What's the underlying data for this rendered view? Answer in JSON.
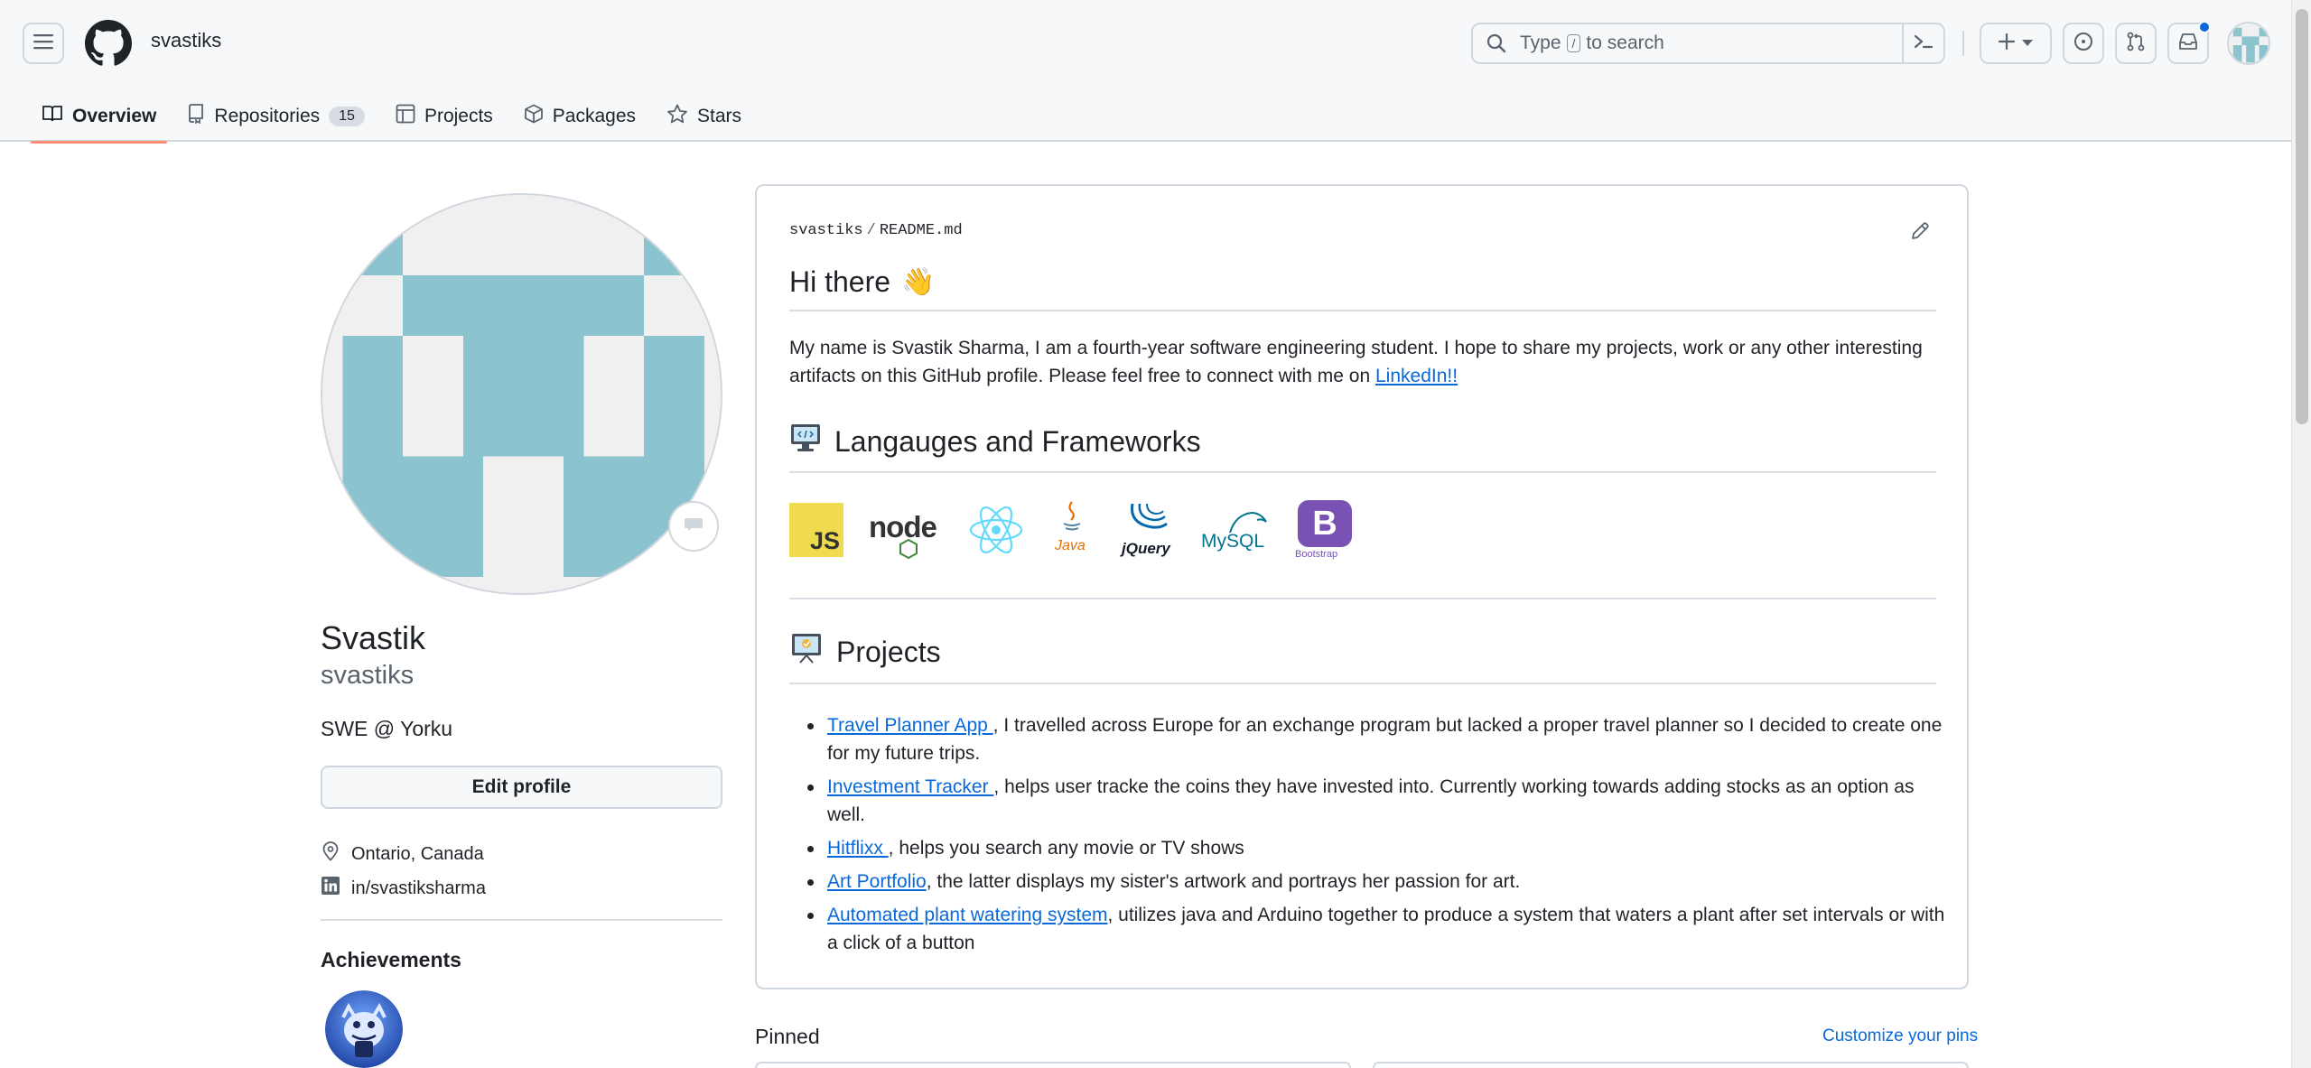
{
  "header": {
    "owner": "svastiks",
    "search": {
      "prefix": "Type",
      "key": "/",
      "suffix": "to search"
    },
    "create_label": "+"
  },
  "tabs": [
    {
      "label": "Overview",
      "icon": "book-icon",
      "active": true
    },
    {
      "label": "Repositories",
      "icon": "repo-icon",
      "count": "15"
    },
    {
      "label": "Projects",
      "icon": "table-icon"
    },
    {
      "label": "Packages",
      "icon": "package-icon"
    },
    {
      "label": "Stars",
      "icon": "star-icon"
    }
  ],
  "profile": {
    "display_name": "Svastik",
    "login": "svastiks",
    "bio": "SWE @ Yorku",
    "edit_label": "Edit profile",
    "location": "Ontario, Canada",
    "linkedin": "in/svastiksharma",
    "achievements_title": "Achievements"
  },
  "readme": {
    "path_owner": "svastiks",
    "path_sep": "/",
    "path_file": "README.md",
    "heading": "Hi there",
    "heading_emoji": "👋",
    "intro": "My name is Svastik Sharma, I am a fourth-year software engineering student. I hope to share my projects, work or any other interesting artifacts on this GitHub profile. Please feel free to connect with me on",
    "linkedin_link": "LinkedIn!!",
    "languages_heading": "Langauges and Frameworks",
    "tech": [
      {
        "name": "JS",
        "color": "#f0db4f"
      },
      {
        "name": "node",
        "color": "#3c873a"
      },
      {
        "name": "React",
        "color": "#61dafb"
      },
      {
        "name": "Java",
        "color": "#e76f00"
      },
      {
        "name": "jQuery",
        "color": "#0769ad"
      },
      {
        "name": "MySQL",
        "color": "#00758f"
      },
      {
        "name": "Bootstrap",
        "color": "#7952b3"
      }
    ],
    "projects_heading": "Projects",
    "projects": [
      {
        "link": "Travel Planner App ",
        "text": ", I travelled across Europe for an exchange program but lacked a proper travel planner so I decided to create one for my future trips."
      },
      {
        "link": "Investment Tracker ",
        "text": ", helps user tracke the coins they have invested into. Currently working towards adding stocks as an option as well."
      },
      {
        "link": "Hitflixx ",
        "text": ", helps you search any movie or TV shows"
      },
      {
        "link": "Art Portfolio",
        "text": ", the latter displays my sister's artwork and portrays her passion for art."
      },
      {
        "link": "Automated plant watering system",
        "text": ", utilizes java and Arduino together to produce a system that waters a plant after set intervals or with a click of a button"
      }
    ]
  },
  "pinned": {
    "title": "Pinned",
    "customize": "Customize your pins"
  },
  "colors": {
    "accent": "#0969da",
    "tab_underline": "#fd8c73",
    "avatar_teal": "#8bc3cf"
  }
}
